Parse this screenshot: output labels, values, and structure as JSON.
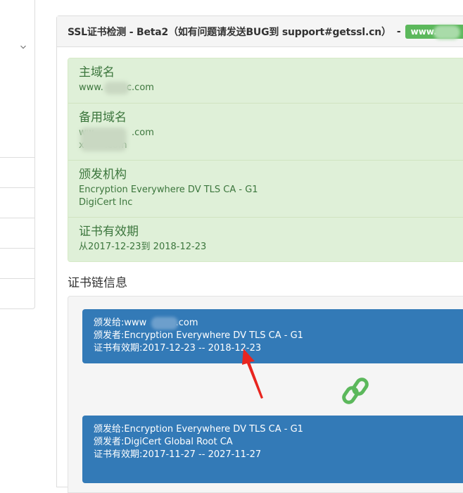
{
  "panel": {
    "title": "SSL证书检测 - Beta2（如有问题请发送BUG到 support#getssl.cn）",
    "separator": "-",
    "domain_badge": {
      "text_left": "www.",
      "text_right": "om",
      "color": "#5cb85c"
    }
  },
  "info": [
    {
      "label": "主域名",
      "values": [
        "www.        c.com"
      ]
    },
    {
      "label": "备用域名",
      "values": [
        "ww             .com",
        "x       .com"
      ]
    },
    {
      "label": "颁发机构",
      "values": [
        "Encryption Everywhere DV TLS CA - G1",
        "DigiCert Inc"
      ]
    },
    {
      "label": "证书有效期",
      "values": [
        "从2017-12-23到 2018-12-23"
      ]
    }
  ],
  "chain": {
    "title": "证书链信息",
    "certs": [
      {
        "issued_to": "颁发给:www          .com",
        "issuer": "颁发者:Encryption Everywhere DV TLS CA - G1",
        "validity": "证书有效期:2017-12-23 -- 2018-12-23"
      },
      {
        "issued_to": "颁发给:Encryption Everywhere DV TLS CA - G1",
        "issuer": "颁发者:DigiCert Global Root CA",
        "validity": "证书有效期:2017-11-27 -- 2027-11-27"
      }
    ],
    "link_icon": "link-icon",
    "link_color": "#5cb85c",
    "card_color": "#337ab7"
  },
  "annotation": {
    "arrow_color": "#e8251f"
  },
  "sidebar": {
    "caret_icon": "chevron-down-icon"
  }
}
